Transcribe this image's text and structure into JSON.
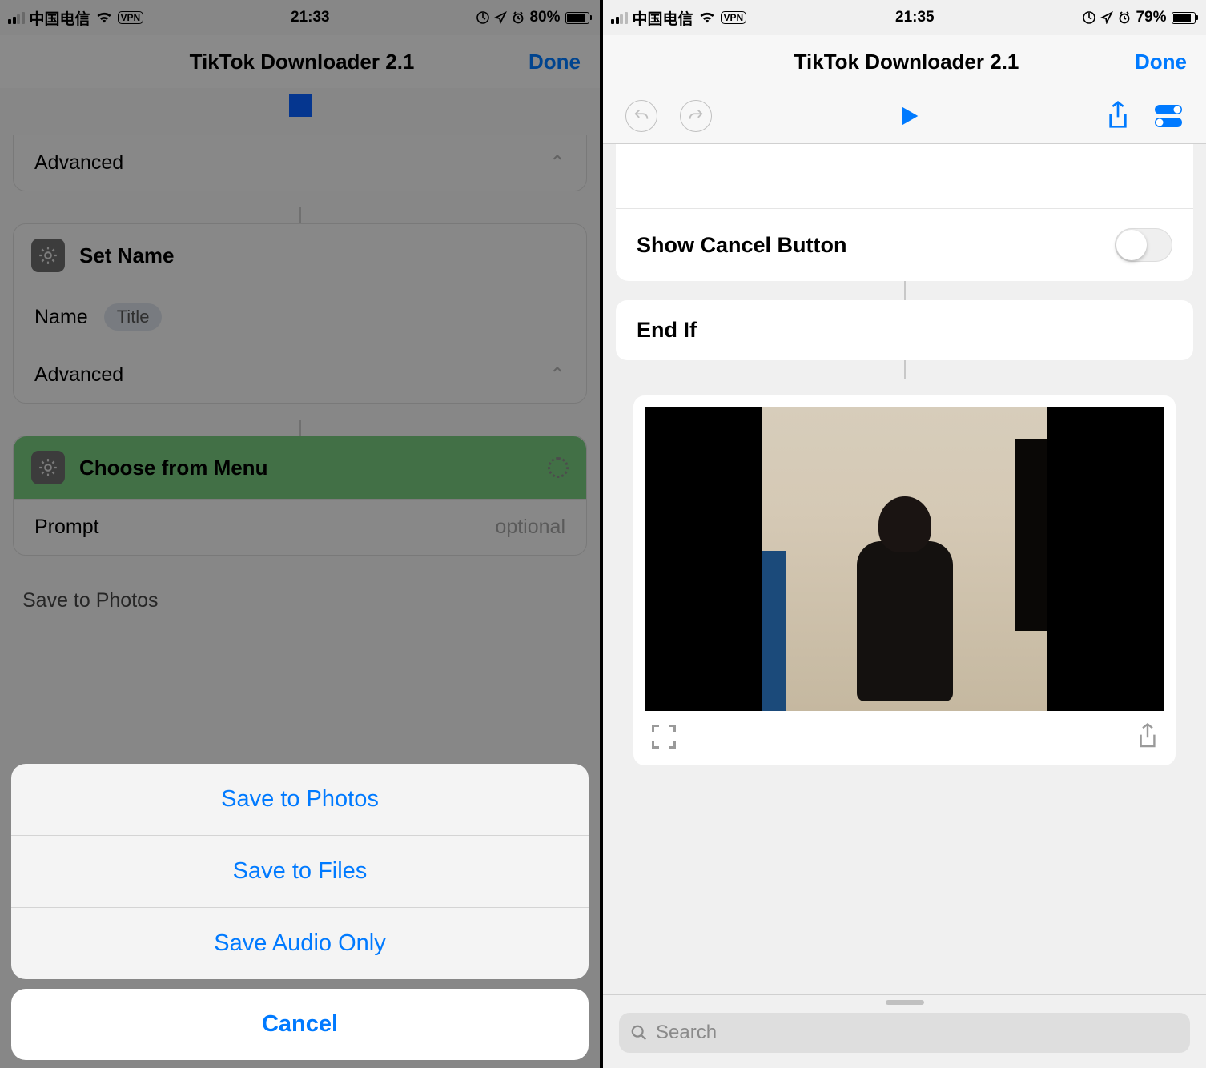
{
  "left": {
    "status": {
      "carrier": "中国电信",
      "vpn": "VPN",
      "time": "21:33",
      "battery_pct": "80%"
    },
    "nav": {
      "title": "TikTok Downloader 2.1",
      "done": "Done"
    },
    "cards": {
      "advanced1": "Advanced",
      "set_name": "Set Name",
      "name_label": "Name",
      "name_token": "Title",
      "advanced2": "Advanced",
      "choose_menu": "Choose from Menu",
      "prompt_label": "Prompt",
      "prompt_placeholder": "optional",
      "peek": "Save to Photos"
    },
    "sheet": {
      "opt1": "Save to Photos",
      "opt2": "Save to Files",
      "opt3": "Save Audio Only",
      "cancel": "Cancel"
    }
  },
  "right": {
    "status": {
      "carrier": "中国电信",
      "vpn": "VPN",
      "time": "21:35",
      "battery_pct": "79%"
    },
    "nav": {
      "title": "TikTok Downloader 2.1",
      "done": "Done"
    },
    "rows": {
      "show_cancel": "Show Cancel Button",
      "end_if": "End If"
    },
    "search_placeholder": "Search"
  }
}
